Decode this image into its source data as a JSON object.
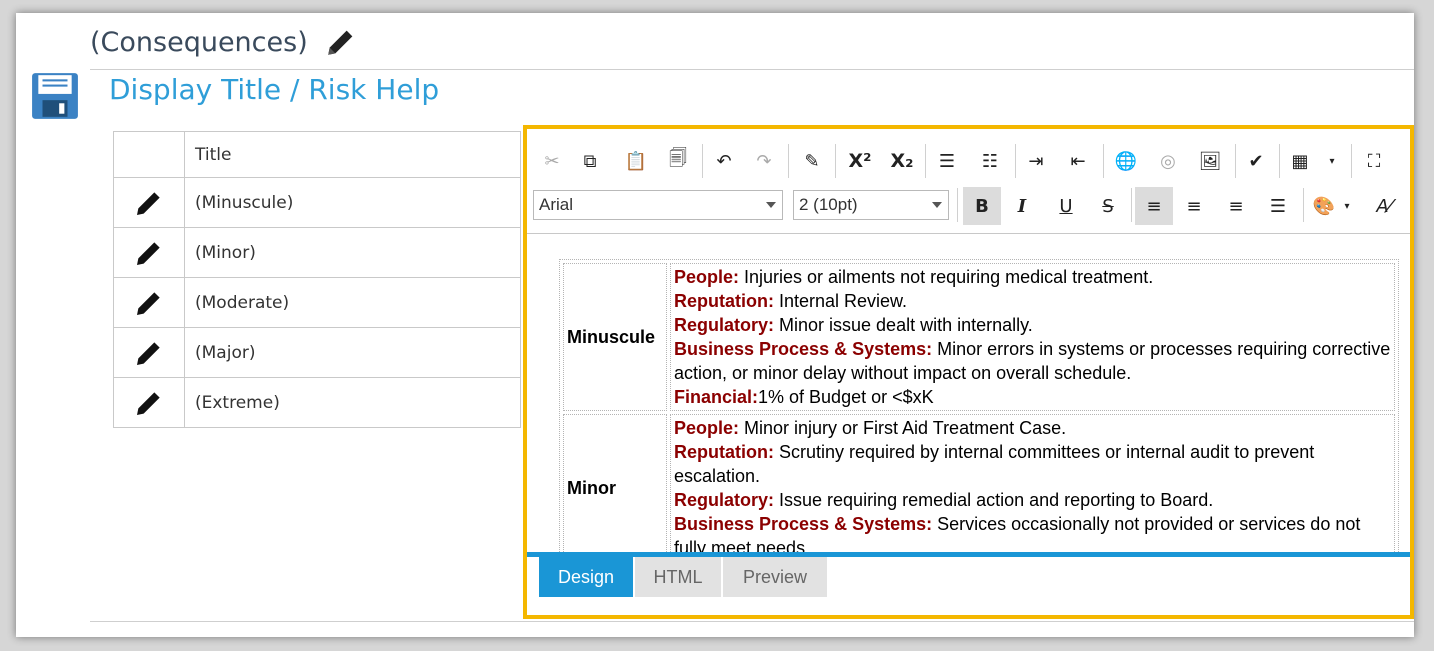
{
  "header": {
    "title": "(Consequences)",
    "edit_icon": "pencil-icon"
  },
  "subtitle": "Display Title / Risk Help",
  "save_icon": "floppy-disk-icon",
  "grid": {
    "column_title": "Title",
    "rows": [
      "(Minuscule)",
      "(Minor)",
      "(Moderate)",
      "(Major)",
      "(Extreme)"
    ]
  },
  "editor": {
    "font_name": "Arial",
    "font_size": "2 (10pt)",
    "toolbar_glyphs": {
      "superscript": "X²",
      "subscript": "X₂",
      "bold": "B",
      "italic": "I",
      "underline": "U",
      "strike": "S"
    },
    "content": [
      {
        "level": "Minuscule",
        "lines": [
          {
            "label": "People:",
            "text": " Injuries or ailments not requiring medical treatment."
          },
          {
            "label": "Reputation:",
            "text": " Internal Review."
          },
          {
            "label": "Regulatory:",
            "text": " Minor issue dealt with internally."
          },
          {
            "label": "Business Process & Systems:",
            "text": " Minor errors in systems or processes requiring corrective action, or minor delay without impact on overall schedule."
          },
          {
            "label": "Financial:",
            "text": "1% of Budget or <$xK"
          }
        ]
      },
      {
        "level": "Minor",
        "lines": [
          {
            "label": "People:",
            "text": " Minor injury or First Aid Treatment Case."
          },
          {
            "label": "Reputation:",
            "text": " Scrutiny required by internal committees or internal audit to prevent escalation."
          },
          {
            "label": "Regulatory:",
            "text": " Issue requiring remedial action and reporting to Board."
          },
          {
            "label": "Business Process & Systems:",
            "text": " Services occasionally not provided or services do not fully meet needs."
          }
        ]
      }
    ],
    "modes": [
      "Design",
      "HTML",
      "Preview"
    ],
    "active_mode": "Design"
  },
  "colors": {
    "accent": "#1a96d6",
    "highlight_border": "#f4b700",
    "label_red": "#8b0000"
  }
}
